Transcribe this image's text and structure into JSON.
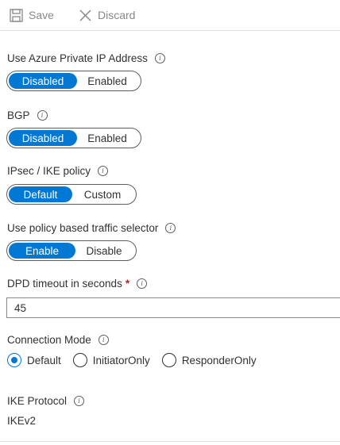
{
  "toolbar": {
    "save_label": "Save",
    "discard_label": "Discard",
    "save_icon": "save-icon",
    "discard_icon": "close-icon"
  },
  "fields": {
    "private_ip": {
      "label": "Use Azure Private IP Address",
      "options": [
        "Disabled",
        "Enabled"
      ],
      "selected": "Disabled"
    },
    "bgp": {
      "label": "BGP",
      "options": [
        "Disabled",
        "Enabled"
      ],
      "selected": "Disabled"
    },
    "ipsec": {
      "label": "IPsec / IKE policy",
      "options": [
        "Default",
        "Custom"
      ],
      "selected": "Default"
    },
    "policy_selector": {
      "label": "Use policy based traffic selector",
      "options": [
        "Enable",
        "Disable"
      ],
      "selected": "Enable"
    },
    "dpd": {
      "label": "DPD timeout in seconds",
      "required_mark": "*",
      "value": "45"
    },
    "connection_mode": {
      "label": "Connection Mode",
      "options": [
        "Default",
        "InitiatorOnly",
        "ResponderOnly"
      ],
      "selected": "Default"
    },
    "ike_protocol": {
      "label": "IKE Protocol",
      "value": "IKEv2"
    }
  },
  "colors": {
    "accent": "#0078d4",
    "text": "#323130",
    "muted": "#8a8886",
    "required": "#a4262c"
  }
}
